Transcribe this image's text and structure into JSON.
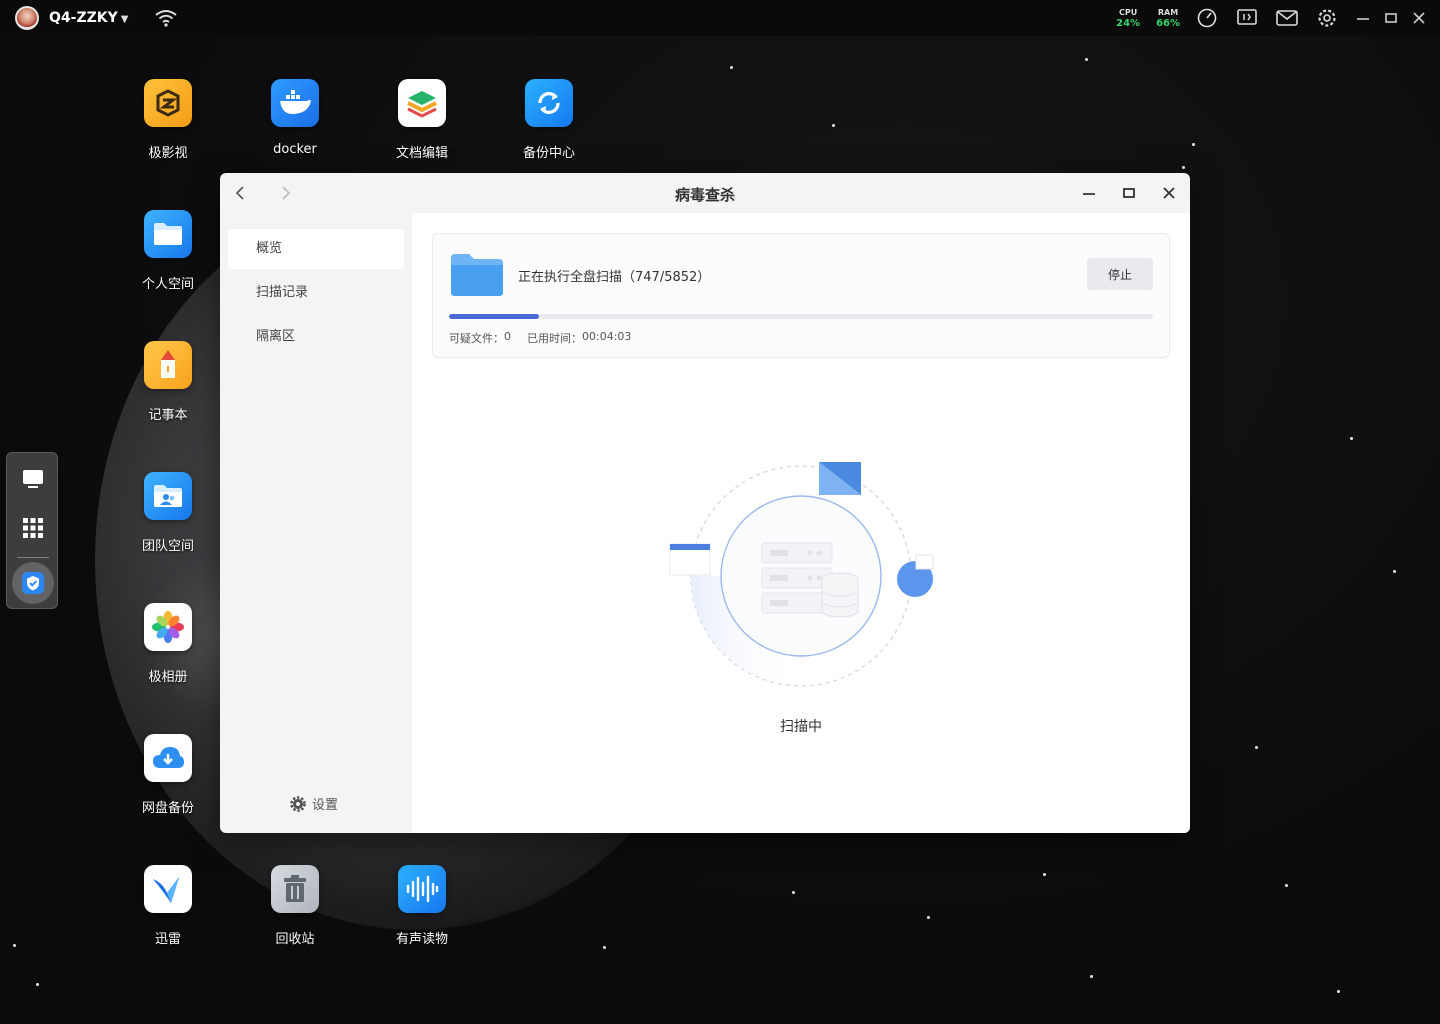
{
  "topbar": {
    "device_name": "Q4-ZZKY",
    "cpu_label": "CPU",
    "cpu_value": "24%",
    "ram_label": "RAM",
    "ram_value": "66%",
    "accent_green": "#37d36b"
  },
  "desktop": {
    "apps": [
      {
        "name": "极影视",
        "icon": "film-icon"
      },
      {
        "name": "docker",
        "icon": "docker-whale-icon"
      },
      {
        "name": "文档编辑",
        "icon": "layers-icon"
      },
      {
        "name": "备份中心",
        "icon": "sync-icon"
      },
      {
        "name": "个人空间",
        "icon": "folder-icon"
      },
      {
        "name": "记事本",
        "icon": "notebook-icon"
      },
      {
        "name": "团队空间",
        "icon": "team-folder-icon"
      },
      {
        "name": "极相册",
        "icon": "photo-flower-icon"
      },
      {
        "name": "网盘备份",
        "icon": "cloud-download-icon"
      },
      {
        "name": "迅雷",
        "icon": "thunder-bird-icon"
      },
      {
        "name": "回收站",
        "icon": "trash-icon"
      },
      {
        "name": "有声读物",
        "icon": "audio-wave-icon"
      }
    ]
  },
  "window": {
    "title": "病毒查杀",
    "sidebar": {
      "items": [
        {
          "label": "概览",
          "active": true
        },
        {
          "label": "扫描记录",
          "active": false
        },
        {
          "label": "隔离区",
          "active": false
        }
      ],
      "settings_label": "设置"
    },
    "scan": {
      "status": "正在执行全盘扫描（747/5852）",
      "stop_label": "停止",
      "progress_fraction": 0.1277,
      "suspicious_label": "可疑文件：",
      "suspicious_value": "0",
      "elapsed_label": "已用时间：",
      "elapsed_value": "00:04:03",
      "progress_color": "#4b69d9"
    },
    "illustration_caption": "扫描中"
  }
}
